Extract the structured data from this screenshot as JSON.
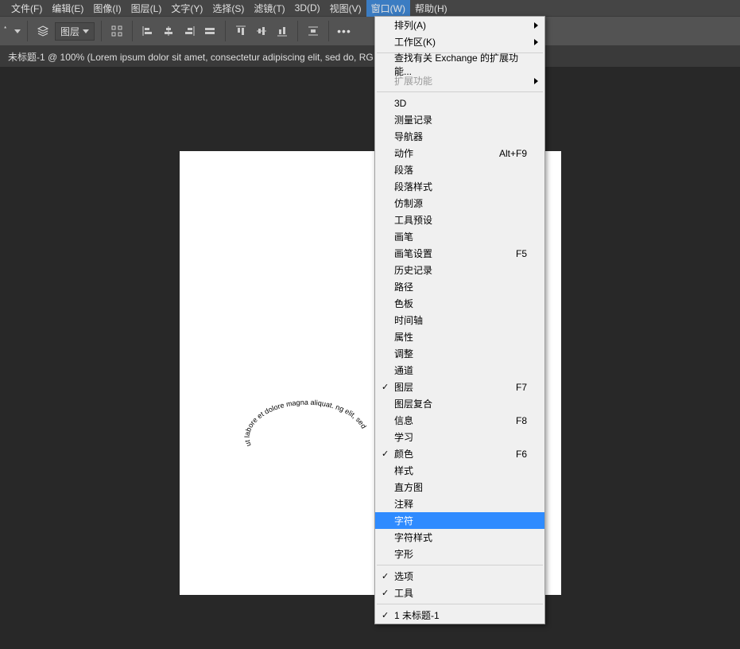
{
  "menubar": {
    "items": [
      "文件(F)",
      "编辑(E)",
      "图像(I)",
      "图层(L)",
      "文字(Y)",
      "选择(S)",
      "滤镜(T)",
      "3D(D)",
      "视图(V)",
      "窗口(W)",
      "帮助(H)"
    ],
    "active_index": 9
  },
  "toolbar": {
    "layer_label": "图层"
  },
  "docbar": {
    "title": "未标题-1 @ 100% (Lorem ipsum dolor sit amet, consectetur adipiscing elit, sed do, RG"
  },
  "canvas": {
    "curved_text": "ut labore et dolore magna aliquat. ng elit, sed do eiusmod tempor incididunt"
  },
  "dropdown": {
    "sections": [
      [
        {
          "label": "排列(A)",
          "submenu": true
        },
        {
          "label": "工作区(K)",
          "submenu": true
        }
      ],
      [
        {
          "label": "查找有关 Exchange 的扩展功能..."
        },
        {
          "label": "扩展功能",
          "submenu": true,
          "disabled": true
        }
      ],
      [
        {
          "label": "3D"
        },
        {
          "label": "测量记录"
        },
        {
          "label": "导航器"
        },
        {
          "label": "动作",
          "shortcut": "Alt+F9"
        },
        {
          "label": "段落"
        },
        {
          "label": "段落样式"
        },
        {
          "label": "仿制源"
        },
        {
          "label": "工具预设"
        },
        {
          "label": "画笔"
        },
        {
          "label": "画笔设置",
          "shortcut": "F5"
        },
        {
          "label": "历史记录"
        },
        {
          "label": "路径"
        },
        {
          "label": "色板"
        },
        {
          "label": "时间轴"
        },
        {
          "label": "属性"
        },
        {
          "label": "调整"
        },
        {
          "label": "通道"
        },
        {
          "label": "图层",
          "shortcut": "F7",
          "checked": true
        },
        {
          "label": "图层复合"
        },
        {
          "label": "信息",
          "shortcut": "F8"
        },
        {
          "label": "学习"
        },
        {
          "label": "颜色",
          "shortcut": "F6",
          "checked": true
        },
        {
          "label": "样式"
        },
        {
          "label": "直方图"
        },
        {
          "label": "注释"
        },
        {
          "label": "字符",
          "highlight": true
        },
        {
          "label": "字符样式"
        },
        {
          "label": "字形"
        }
      ],
      [
        {
          "label": "选项",
          "checked": true
        },
        {
          "label": "工具",
          "checked": true
        }
      ],
      [
        {
          "label": "1 未标题-1",
          "checked": true
        }
      ]
    ]
  }
}
